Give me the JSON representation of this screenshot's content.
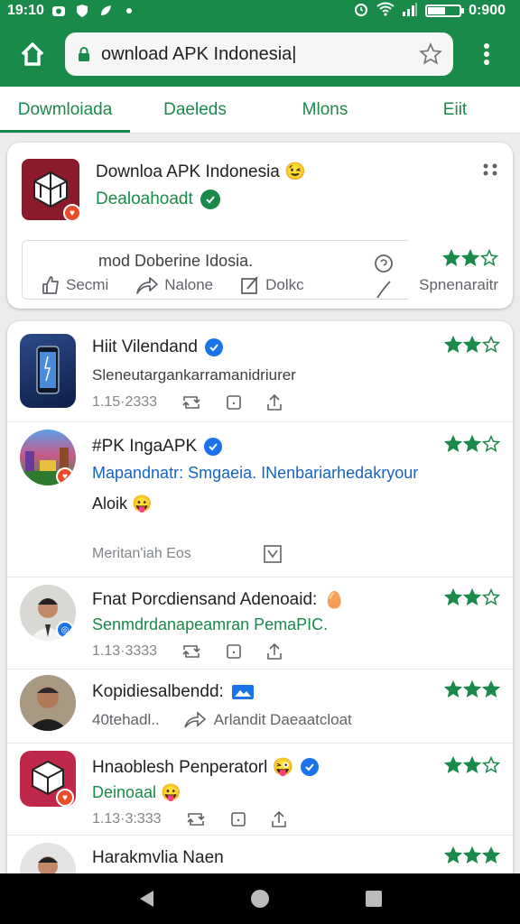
{
  "status": {
    "time": "19:10",
    "clock": "0:900",
    "battery_level": 0.55
  },
  "toolbar": {
    "url": "ownload APK Indonesia|"
  },
  "tabs": [
    {
      "label": "Dowmloiada",
      "active": true
    },
    {
      "label": "Daeleds",
      "active": false
    },
    {
      "label": "Mlons",
      "active": false
    },
    {
      "label": "Eiit",
      "active": false
    }
  ],
  "top_card": {
    "title": "Downloa APK Indonesia 😉",
    "subtitle": "Dealoahoadt",
    "description": "mod Doberine Idosia.",
    "actions": [
      "Secmi",
      "Nalone",
      "Dolkc"
    ],
    "side_label": "Spnenaraitr",
    "rating": 2
  },
  "posts": [
    {
      "name": "Hiit Vilendand",
      "line2": "Sleneutargankarramanidriurer",
      "meta": "1.15·2333",
      "rating": 2
    },
    {
      "name": "#PK IngaAPK",
      "line2": "Mapandnatr: Smgaeia. INenbariarhedakryour",
      "line3": "Aloik 😛",
      "meta": "Meritan'iah Eos",
      "rating": 2
    },
    {
      "name": "Fnat Porcdiensand Adenoaid:",
      "line2": "Senmdrdanapeamran PemaPIC.",
      "meta": "1.13·3333",
      "rating": 2
    },
    {
      "name": "Kopidiesalbendd:",
      "line2": "40tehadl..",
      "meta": "Arlandit Daeaatcloat",
      "rating": 3
    },
    {
      "name": "Hnaoblesh Penperatorl 😜",
      "line2": "Deinoaal 😛",
      "meta": "1.13·3:333",
      "rating": 2
    },
    {
      "name": "Harakmvlia Naen",
      "rating": 3
    }
  ],
  "colors": {
    "accent": "#1a8a4a",
    "link": "#1565c0",
    "verify": "#1a73e8",
    "badge": "#e84d2b"
  },
  "icons": [
    "home-icon",
    "lock-icon",
    "star-outline-icon",
    "overflow-menu-icon",
    "verified-icon",
    "like-icon",
    "share-icon",
    "edit-icon",
    "retweet-icon",
    "comment-icon",
    "upload-icon",
    "back-icon",
    "home-circle-icon",
    "recents-icon"
  ]
}
